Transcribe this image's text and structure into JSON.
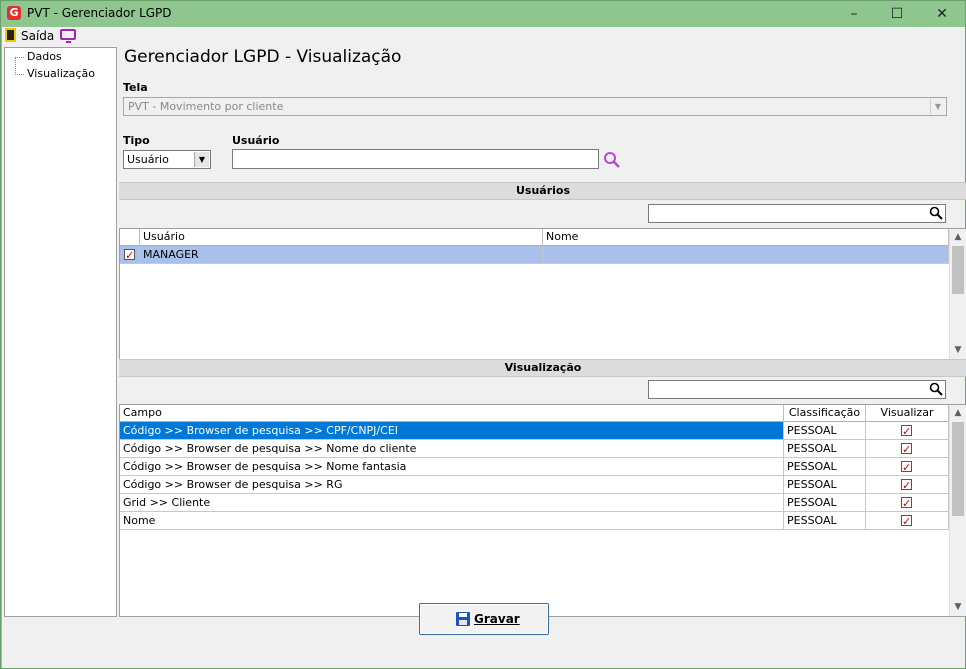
{
  "window": {
    "title": "PVT - Gerenciador LGPD",
    "logo_letter": "G"
  },
  "menu": {
    "exit_label": "Saída"
  },
  "tree": {
    "items": [
      "Dados",
      "Visualização"
    ]
  },
  "page_title": "Gerenciador LGPD - Visualização",
  "tela": {
    "label": "Tela",
    "value": "PVT - Movimento por cliente"
  },
  "tipo": {
    "label": "Tipo",
    "value": "Usuário"
  },
  "usuario": {
    "label": "Usuário",
    "value": ""
  },
  "usuarios_section": {
    "title": "Usuários",
    "search_value": "",
    "columns": [
      "Usuário",
      "Nome"
    ],
    "rows": [
      {
        "checked": true,
        "usuario": "MANAGER",
        "nome": ""
      }
    ]
  },
  "visualizacao_section": {
    "title": "Visualização",
    "search_value": "",
    "columns": [
      "Campo",
      "Classificação",
      "Visualizar"
    ],
    "rows": [
      {
        "campo": "Código >> Browser de pesquisa >> CPF/CNPJ/CEI",
        "classificacao": "PESSOAL",
        "visualizar": true
      },
      {
        "campo": "Código >> Browser de pesquisa >> Nome do cliente",
        "classificacao": "PESSOAL",
        "visualizar": true
      },
      {
        "campo": "Código >> Browser de pesquisa >> Nome fantasia",
        "classificacao": "PESSOAL",
        "visualizar": true
      },
      {
        "campo": "Código >> Browser de pesquisa >> RG",
        "classificacao": "PESSOAL",
        "visualizar": true
      },
      {
        "campo": "Grid >> Cliente",
        "classificacao": "PESSOAL",
        "visualizar": true
      },
      {
        "campo": "Nome",
        "classificacao": "PESSOAL",
        "visualizar": true
      }
    ]
  },
  "footer": {
    "save_label": "Gravar"
  },
  "colors": {
    "window_frame": "#8fc58f",
    "selected_row_blue": "#0078d7",
    "selected_row_light": "#a9c1ea",
    "check_red": "#d00000",
    "accent_purple": "#9c27b0"
  }
}
